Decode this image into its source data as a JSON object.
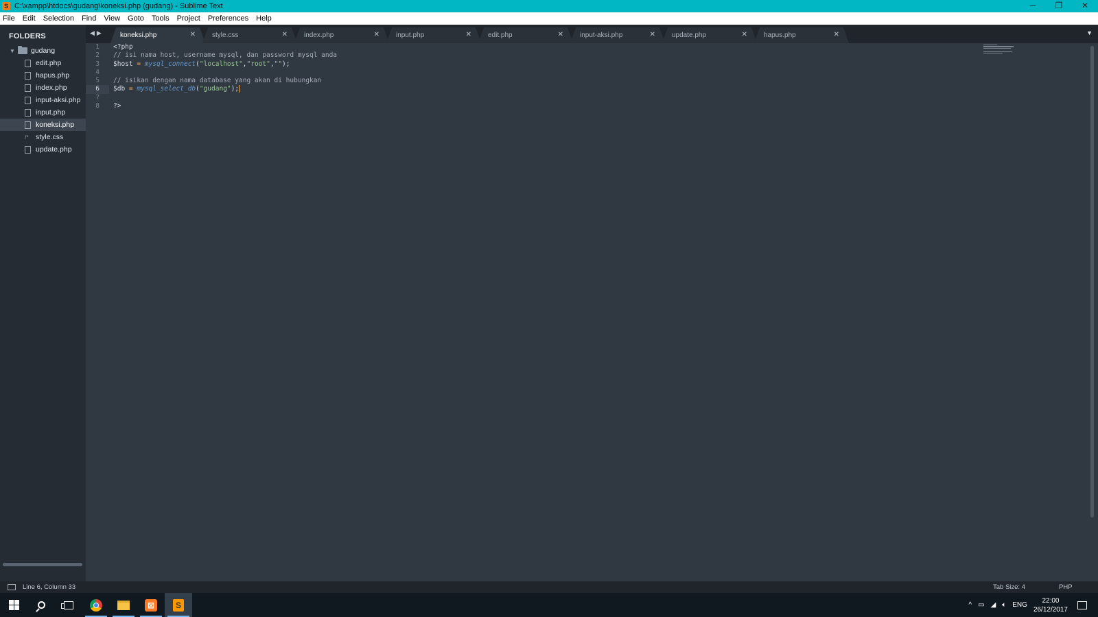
{
  "window": {
    "title": "C:\\xampp\\htdocs\\gudang\\koneksi.php (gudang) - Sublime Text",
    "app_icon_glyph": "S",
    "controls": {
      "minimize": "─",
      "restore": "❐",
      "close": "✕"
    }
  },
  "menu": [
    "File",
    "Edit",
    "Selection",
    "Find",
    "View",
    "Goto",
    "Tools",
    "Project",
    "Preferences",
    "Help"
  ],
  "sidebar": {
    "header": "FOLDERS",
    "root_folder": "gudang",
    "files": [
      {
        "name": "edit.php",
        "icon": "file-icon"
      },
      {
        "name": "hapus.php",
        "icon": "file-icon"
      },
      {
        "name": "index.php",
        "icon": "file-icon"
      },
      {
        "name": "input-aksi.php",
        "icon": "file-icon"
      },
      {
        "name": "input.php",
        "icon": "file-icon"
      },
      {
        "name": "koneksi.php",
        "icon": "file-icon",
        "active": true
      },
      {
        "name": "style.css",
        "icon": "css-comment-icon"
      },
      {
        "name": "update.php",
        "icon": "file-icon"
      }
    ]
  },
  "tabs": [
    {
      "label": "koneksi.php",
      "active": true
    },
    {
      "label": "style.css"
    },
    {
      "label": "index.php"
    },
    {
      "label": "input.php"
    },
    {
      "label": "edit.php"
    },
    {
      "label": "input-aksi.php"
    },
    {
      "label": "update.php"
    },
    {
      "label": "hapus.php"
    }
  ],
  "tab_close_glyph": "✕",
  "editor": {
    "line_numbers": [
      "1",
      "2",
      "3",
      "4",
      "5",
      "6",
      "7",
      "8"
    ],
    "current_line": 6,
    "code": {
      "l1": "<?php",
      "l2": "// isi nama host, username mysql, dan password mysql anda",
      "l3_var": "$host",
      "l3_op": " = ",
      "l3_fn": "mysql_connect",
      "l3_open": "(",
      "l3_s1": "\"localhost\"",
      "l3_c1": ",",
      "l3_s2": "\"root\"",
      "l3_c2": ",",
      "l3_s3": "\"\"",
      "l3_end": ");",
      "l5": "// isikan dengan nama database yang akan di hubungkan",
      "l6_var": "$db",
      "l6_op": " = ",
      "l6_fn": "mysql_select_db",
      "l6_open": "(",
      "l6_s1": "\"gudang\"",
      "l6_end": ");",
      "l8": "?>"
    }
  },
  "status": {
    "position": "Line 6, Column 33",
    "tab_size": "Tab Size: 4",
    "syntax": "PHP"
  },
  "taskbar": {
    "apps": [
      "start-icon",
      "search-icon",
      "task-view-icon",
      "chrome-icon",
      "file-explorer-icon",
      "xampp-icon",
      "sublime-text-icon"
    ],
    "xampp_glyph": "⊠",
    "sublime_glyph": "S",
    "tray": {
      "chevron": "^",
      "language": "ENG",
      "time": "22:00",
      "date": "26/12/2017"
    }
  }
}
